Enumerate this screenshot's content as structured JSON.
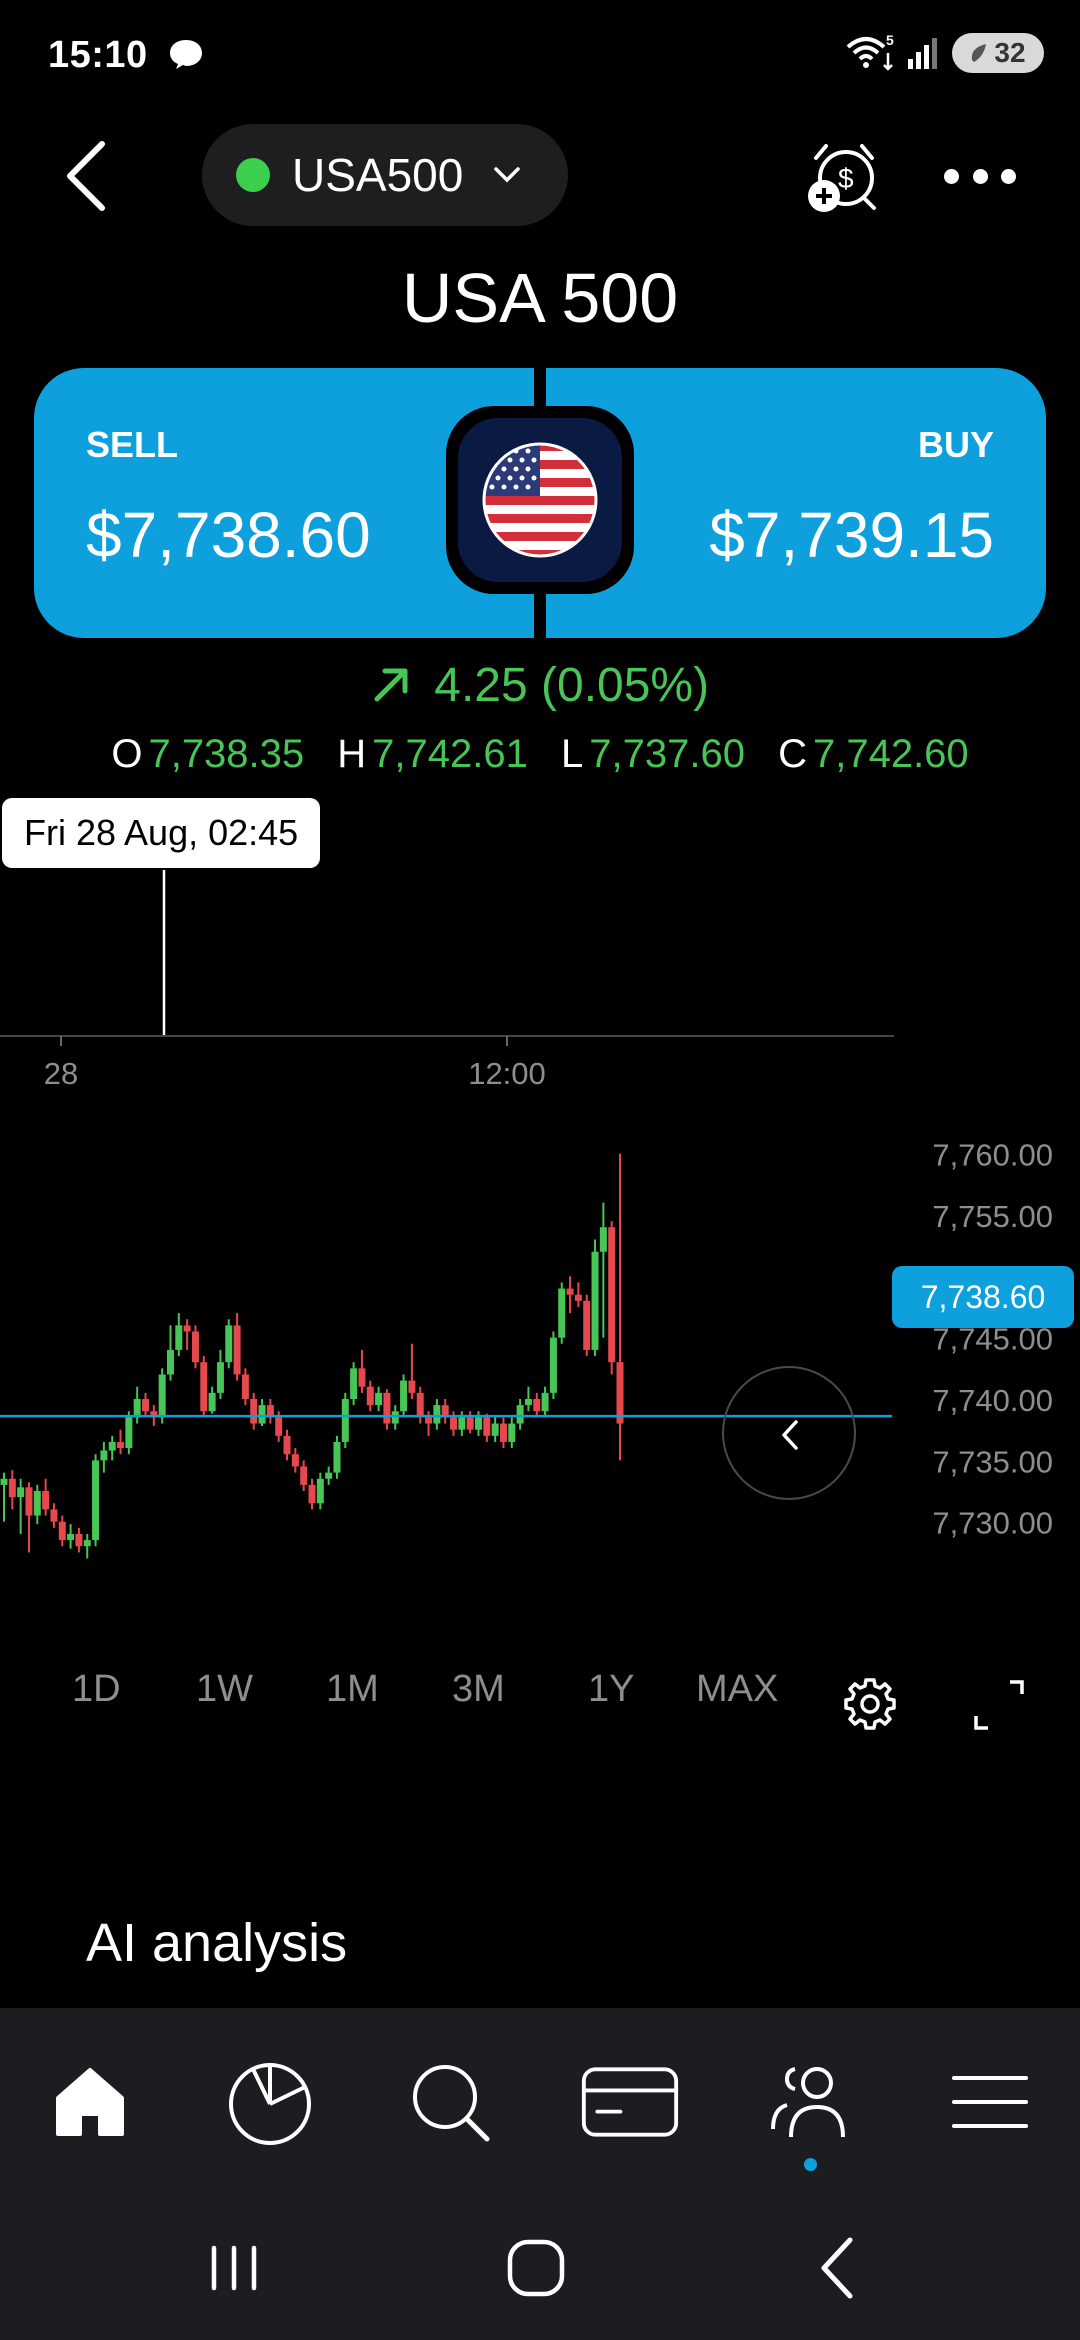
{
  "status_bar": {
    "time": "15:10",
    "battery": "32",
    "network": "5"
  },
  "header": {
    "symbol": "USA500"
  },
  "instrument": {
    "title": "USA 500"
  },
  "trade": {
    "sell_label": "SELL",
    "sell_price": "$7,738.60",
    "buy_label": "BUY",
    "buy_price": "$7,739.15"
  },
  "change": {
    "text": "4.25 (0.05%)"
  },
  "ohlc": {
    "o_label": "O",
    "o_value": "7,738.35",
    "h_label": "H",
    "h_value": "7,742.61",
    "l_label": "L",
    "l_value": "7,737.60",
    "c_label": "C",
    "c_value": "7,742.60"
  },
  "tooltip": "Fri 28 Aug, 02:45",
  "current_price_tag": "7,738.60",
  "ranges": [
    "1D",
    "1W",
    "1M",
    "3M",
    "1Y",
    "MAX"
  ],
  "section_title": "AI analysis",
  "colors": {
    "accent": "#0ea0dd",
    "up": "#47c557",
    "down": "#e5484d",
    "background": "#000000"
  },
  "icons": [
    "back-chevron-icon",
    "chevron-down-icon",
    "price-alert-icon",
    "more-icon",
    "us-flag-icon",
    "arrow-up-right-icon",
    "chevron-left-icon",
    "gear-icon",
    "expand-icon",
    "home-icon",
    "portfolio-pie-icon",
    "search-icon",
    "card-icon",
    "community-icon",
    "menu-icon"
  ],
  "chart_data": {
    "type": "candlestick",
    "y_ticks": [
      "7,760.00",
      "7,755.00",
      "7,750.00",
      "7,745.00",
      "7,740.00",
      "7,735.00",
      "7,730.00"
    ],
    "x_ticks": [
      "28",
      "12:00"
    ],
    "ylim": [
      7726,
      7762
    ],
    "current_price": 7738.6,
    "candles": [
      [
        7733.0,
        7733.5,
        7730.0,
        7734.0
      ],
      [
        7733.5,
        7732.0,
        7731.0,
        7734.2
      ],
      [
        7732.0,
        7732.8,
        7729.0,
        7733.5
      ],
      [
        7732.8,
        7730.5,
        7727.5,
        7733.2
      ],
      [
        7730.5,
        7732.5,
        7729.8,
        7733.0
      ],
      [
        7732.5,
        7731.0,
        7730.5,
        7733.5
      ],
      [
        7731.0,
        7730.0,
        7729.5,
        7731.5
      ],
      [
        7730.0,
        7728.5,
        7728.0,
        7730.5
      ],
      [
        7728.5,
        7729.0,
        7727.8,
        7729.8
      ],
      [
        7729.0,
        7728.0,
        7727.5,
        7729.5
      ],
      [
        7728.0,
        7728.5,
        7727.0,
        7729.0
      ],
      [
        7728.5,
        7735.0,
        7728.0,
        7735.5
      ],
      [
        7735.0,
        7735.8,
        7734.0,
        7736.5
      ],
      [
        7735.8,
        7736.5,
        7735.0,
        7737.0
      ],
      [
        7736.5,
        7736.0,
        7735.5,
        7737.5
      ],
      [
        7736.0,
        7738.5,
        7735.5,
        7739.0
      ],
      [
        7738.5,
        7740.0,
        7738.0,
        7741.0
      ],
      [
        7740.0,
        7739.0,
        7738.5,
        7740.5
      ],
      [
        7739.0,
        7738.5,
        7737.8,
        7739.5
      ],
      [
        7738.5,
        7742.0,
        7738.0,
        7742.5
      ],
      [
        7742.0,
        7744.0,
        7741.5,
        7746.0
      ],
      [
        7744.0,
        7746.0,
        7743.5,
        7747.0
      ],
      [
        7746.0,
        7745.5,
        7744.0,
        7746.5
      ],
      [
        7745.5,
        7743.0,
        7742.5,
        7746.0
      ],
      [
        7743.0,
        7739.0,
        7738.5,
        7743.5
      ],
      [
        7739.0,
        7740.5,
        7738.8,
        7741.0
      ],
      [
        7740.5,
        7743.0,
        7740.0,
        7744.0
      ],
      [
        7743.0,
        7746.0,
        7742.5,
        7746.5
      ],
      [
        7746.0,
        7742.0,
        7741.5,
        7747.0
      ],
      [
        7742.0,
        7740.0,
        7739.5,
        7742.5
      ],
      [
        7740.0,
        7738.0,
        7737.5,
        7740.5
      ],
      [
        7738.0,
        7739.5,
        7737.8,
        7740.0
      ],
      [
        7739.5,
        7738.5,
        7738.0,
        7740.0
      ],
      [
        7738.5,
        7737.0,
        7736.5,
        7739.0
      ],
      [
        7737.0,
        7735.5,
        7735.0,
        7737.5
      ],
      [
        7735.5,
        7734.5,
        7734.0,
        7736.0
      ],
      [
        7734.5,
        7733.0,
        7732.5,
        7735.0
      ],
      [
        7733.0,
        7731.5,
        7731.0,
        7733.5
      ],
      [
        7731.5,
        7733.5,
        7731.0,
        7734.0
      ],
      [
        7733.5,
        7734.0,
        7733.0,
        7734.5
      ],
      [
        7734.0,
        7736.5,
        7733.5,
        7737.0
      ],
      [
        7736.5,
        7740.0,
        7736.0,
        7740.5
      ],
      [
        7740.0,
        7742.5,
        7739.5,
        7743.0
      ],
      [
        7742.5,
        7741.0,
        7740.5,
        7744.0
      ],
      [
        7741.0,
        7739.5,
        7739.0,
        7741.5
      ],
      [
        7739.5,
        7740.5,
        7739.0,
        7741.0
      ],
      [
        7740.5,
        7738.0,
        7737.5,
        7740.8
      ],
      [
        7738.0,
        7739.0,
        7737.5,
        7739.5
      ],
      [
        7739.0,
        7741.5,
        7738.5,
        7742.0
      ],
      [
        7741.5,
        7740.5,
        7740.0,
        7744.5
      ],
      [
        7740.5,
        7738.5,
        7738.0,
        7741.0
      ],
      [
        7738.5,
        7738.0,
        7737.0,
        7739.0
      ],
      [
        7738.0,
        7739.5,
        7737.5,
        7740.0
      ],
      [
        7739.5,
        7738.5,
        7738.0,
        7740.0
      ],
      [
        7738.5,
        7737.5,
        7737.0,
        7739.0
      ],
      [
        7737.5,
        7738.5,
        7737.0,
        7739.0
      ],
      [
        7738.5,
        7737.5,
        7737.2,
        7739.0
      ],
      [
        7737.5,
        7738.5,
        7737.0,
        7739.0
      ],
      [
        7738.5,
        7737.0,
        7736.5,
        7738.8
      ],
      [
        7737.0,
        7738.0,
        7736.5,
        7738.5
      ],
      [
        7738.0,
        7736.5,
        7736.0,
        7738.5
      ],
      [
        7736.5,
        7738.0,
        7736.0,
        7738.5
      ],
      [
        7738.0,
        7739.5,
        7737.5,
        7740.0
      ],
      [
        7739.5,
        7740.0,
        7739.0,
        7741.0
      ],
      [
        7740.0,
        7739.0,
        7738.5,
        7740.5
      ],
      [
        7739.0,
        7740.5,
        7738.5,
        7741.0
      ],
      [
        7740.5,
        7745.0,
        7740.0,
        7745.5
      ],
      [
        7745.0,
        7749.0,
        7744.5,
        7749.5
      ],
      [
        7749.0,
        7748.5,
        7747.0,
        7750.0
      ],
      [
        7748.5,
        7748.0,
        7747.5,
        7749.5
      ],
      [
        7748.0,
        7744.0,
        7743.5,
        7748.5
      ],
      [
        7744.0,
        7752.0,
        7743.5,
        7753.0
      ],
      [
        7752.0,
        7754.0,
        7745.0,
        7756.0
      ],
      [
        7754.0,
        7743.0,
        7742.0,
        7754.5
      ],
      [
        7743.0,
        7738.0,
        7735.0,
        7760.0
      ]
    ]
  }
}
